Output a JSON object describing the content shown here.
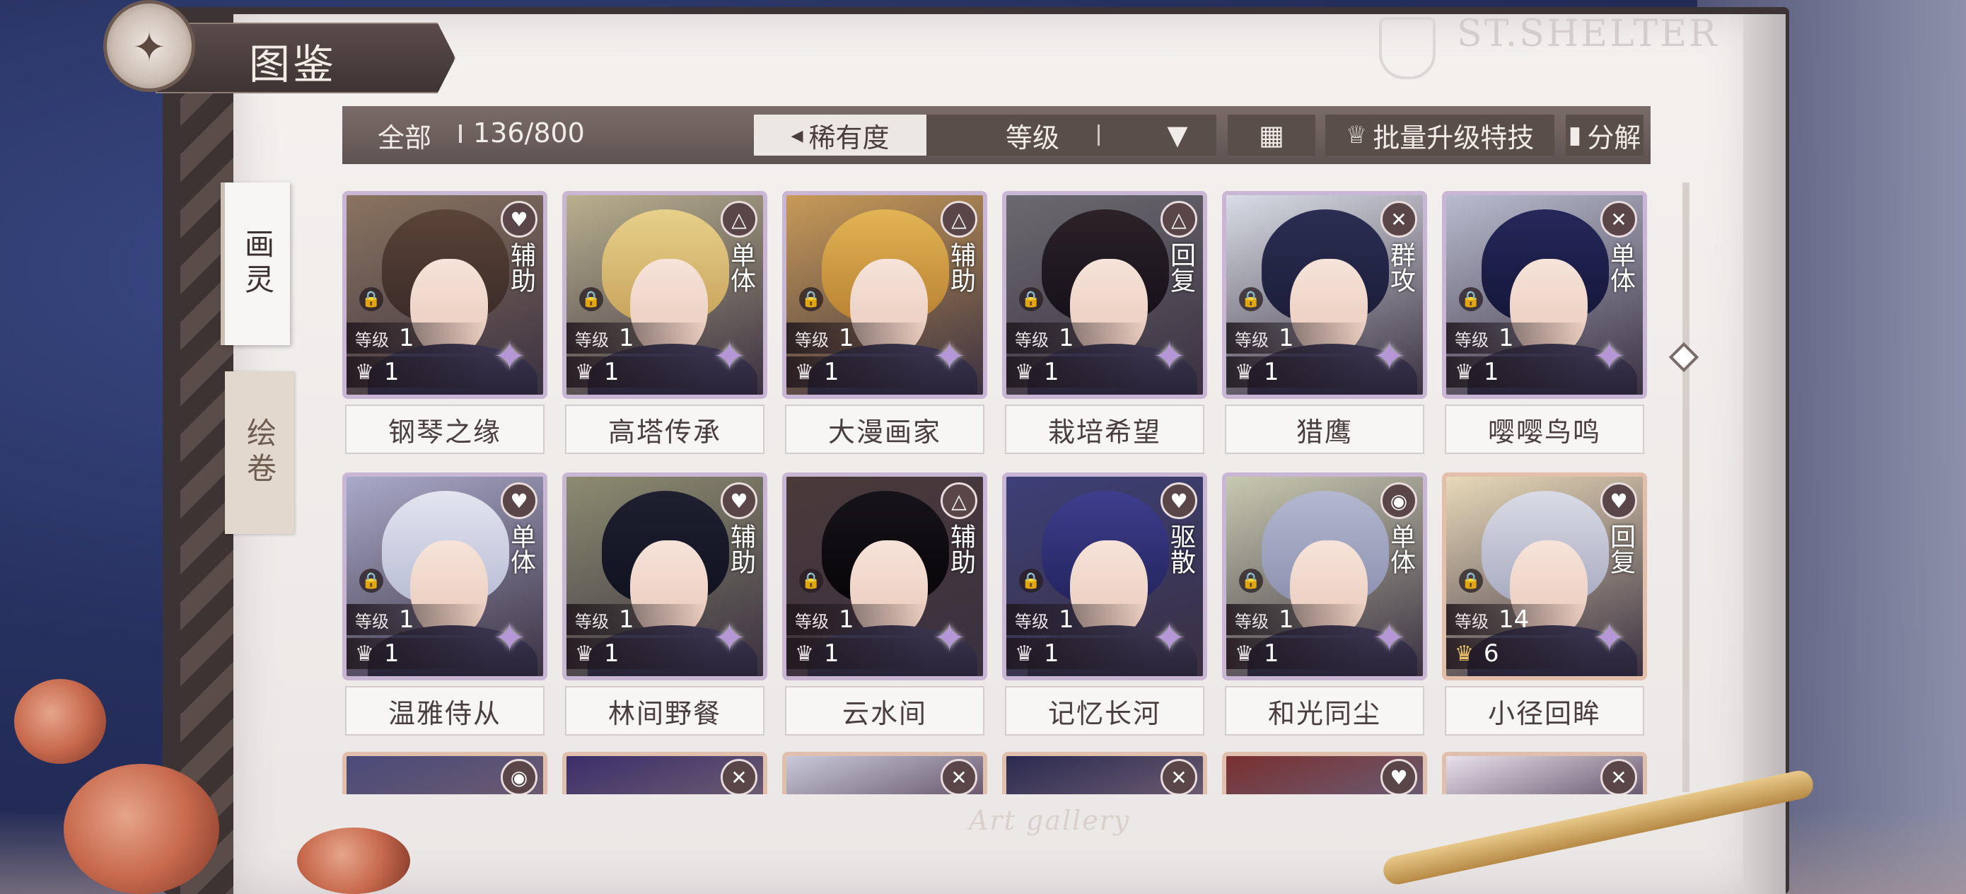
{
  "header": {
    "title": "图鉴",
    "logo_text": "ST.SHELTER"
  },
  "side_tabs": [
    {
      "label": "画灵",
      "active": true
    },
    {
      "label": "绘卷",
      "active": false
    }
  ],
  "toolbar": {
    "filter_all": "全部",
    "count": "136/800",
    "sort_rarity": "稀有度",
    "sort_level": "等级",
    "batch_upgrade": "批量升级特技",
    "decompose": "分解"
  },
  "footer_text": "Art gallery",
  "cards": [
    {
      "name": "钢琴之缘",
      "type": "辅助",
      "type_icon": "heartbeat-icon",
      "level": "1",
      "stars": "1",
      "locked": true,
      "rarity": "purple"
    },
    {
      "name": "高塔传承",
      "type": "单体",
      "type_icon": "triangle-icon",
      "level": "1",
      "stars": "1",
      "locked": true,
      "rarity": "purple"
    },
    {
      "name": "大漫画家",
      "type": "辅助",
      "type_icon": "triangle-icon",
      "level": "1",
      "stars": "1",
      "locked": true,
      "rarity": "purple"
    },
    {
      "name": "栽培希望",
      "type": "回复",
      "type_icon": "triangle-icon",
      "level": "1",
      "stars": "1",
      "locked": true,
      "rarity": "purple"
    },
    {
      "name": "猎鹰",
      "type": "群攻",
      "type_icon": "cross-icon",
      "level": "1",
      "stars": "1",
      "locked": true,
      "rarity": "purple"
    },
    {
      "name": "嘤嘤鸟鸣",
      "type": "单体",
      "type_icon": "cross-icon",
      "level": "1",
      "stars": "1",
      "locked": true,
      "rarity": "purple"
    },
    {
      "name": "温雅侍从",
      "type": "单体",
      "type_icon": "heartbeat-icon",
      "level": "1",
      "stars": "1",
      "locked": true,
      "rarity": "purple"
    },
    {
      "name": "林间野餐",
      "type": "辅助",
      "type_icon": "heartbeat-icon",
      "level": "1",
      "stars": "1",
      "locked": false,
      "rarity": "purple"
    },
    {
      "name": "云水间",
      "type": "辅助",
      "type_icon": "triangle-icon",
      "level": "1",
      "stars": "1",
      "locked": true,
      "rarity": "purple"
    },
    {
      "name": "记忆长河",
      "type": "驱散",
      "type_icon": "heartbeat-icon",
      "level": "1",
      "stars": "1",
      "locked": true,
      "rarity": "purple"
    },
    {
      "name": "和光同尘",
      "type": "单体",
      "type_icon": "circle-icon",
      "level": "1",
      "stars": "1",
      "locked": true,
      "rarity": "purple"
    },
    {
      "name": "小径回眸",
      "type": "回复",
      "type_icon": "heartbeat-icon",
      "level": "14",
      "stars": "6",
      "locked": true,
      "rarity": "gold"
    }
  ],
  "partial_row_icons": [
    "circle-icon",
    "cross-icon",
    "cross-icon",
    "cross-icon",
    "heartbeat-icon",
    "cross-icon"
  ],
  "colors": {
    "purple_frame": "#c9b6d5",
    "gold_frame": "#e3bfa9",
    "toolbar_bg": "#6b5e5b"
  }
}
